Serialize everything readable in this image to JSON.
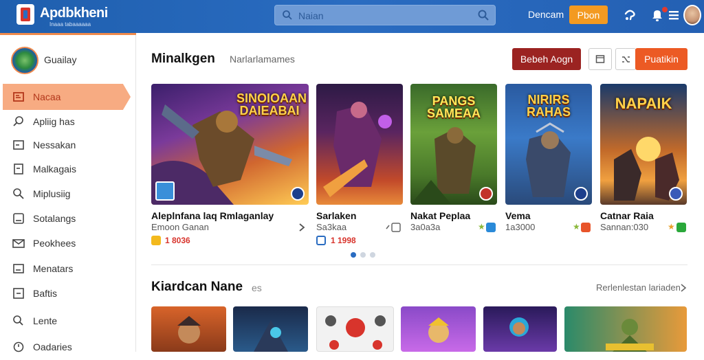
{
  "header": {
    "brand": "Apdbkheni",
    "brand_sub": "Inaaa tabaaaaaa",
    "search_placeholder": "Naian",
    "link": "Dencam",
    "button": "Pbon"
  },
  "sidebar": {
    "user": "Guailay",
    "items": [
      {
        "label": "Nacaa",
        "icon": "home-icon"
      },
      {
        "label": "Apliig has",
        "icon": "search-icon"
      },
      {
        "label": "Nessakan",
        "icon": "square-icon"
      },
      {
        "label": "Malkagais",
        "icon": "square-icon"
      },
      {
        "label": "Miplusiig",
        "icon": "search-icon"
      },
      {
        "label": "Sotalangs",
        "icon": "square-icon"
      },
      {
        "label": "Peokhees",
        "icon": "mail-icon"
      },
      {
        "label": "Menatars",
        "icon": "square-icon"
      },
      {
        "label": "Baftis",
        "icon": "square-icon"
      },
      {
        "label": "Lente",
        "icon": "search-icon"
      },
      {
        "label": "Oadaries",
        "icon": "clock-icon"
      }
    ]
  },
  "section1": {
    "title": "Minalkgen",
    "subtitle": "Narlarlamames",
    "btn_primary": "Bebeh Aogn",
    "btn_orange": "Puatikin",
    "games": [
      {
        "art": "SINOIOAAN DAIEABAI",
        "title": "Aleplnfana laq Rmlaganlay",
        "sub": "Emoon Ganan",
        "price": "1 8036"
      },
      {
        "art": "",
        "title": "Sarlaken",
        "sub": "Sa3kaa",
        "price": "1 1998"
      },
      {
        "art": "PANGS SAMEAA",
        "title": "Nakat Peplaa",
        "sub": "3a0a3a",
        "price": ""
      },
      {
        "art": "NIRIRS RAHAS",
        "title": "Vema",
        "sub": "1a3000",
        "price": ""
      },
      {
        "art": "NAPAIK",
        "title": "Catnar Raia",
        "sub": "Sannan:030",
        "price": ""
      }
    ]
  },
  "section2": {
    "title": "Kiardcan Nane",
    "subtitle": "es",
    "view_all": "Rerlenlestan lariaden"
  }
}
